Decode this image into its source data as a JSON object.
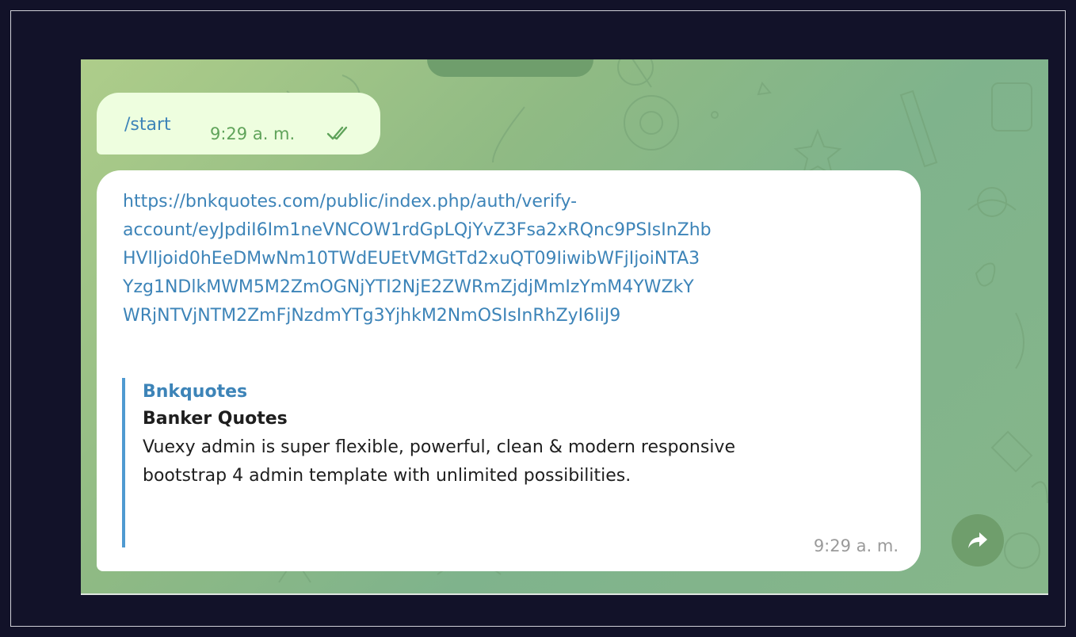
{
  "chat": {
    "outgoing": {
      "text": "/start",
      "time": "9:29 a. m.",
      "status_icon": "double-check-icon"
    },
    "incoming": {
      "link_lines": [
        "https://bnkquotes.com/public/index.php/auth/verify-",
        "account/eyJpdiI6Im1neVNCOW1rdGpLQjYvZ3Fsa2xRQnc9PSIsInZhb",
        "HVlIjoid0hEeDMwNm10TWdEUEtVMGtTd2xuQT09IiwibWFjIjoiNTA3",
        "Yzg1NDlkMWM5M2ZmOGNjYTI2NjE2ZWRmZjdjMmIzYmM4YWZkY",
        "WRjNTVjNTM2ZmFjNzdmYTg3YjhkM2NmOSIsInRhZyI6IiJ9"
      ],
      "preview": {
        "site_name": "Bnkquotes",
        "title": "Banker Quotes",
        "description": "Vuexy admin is super flexible, powerful, clean & modern responsive bootstrap 4 admin template with unlimited possibilities."
      },
      "time": "9:29 a. m."
    },
    "forward_icon": "share-arrow-icon"
  },
  "colors": {
    "page_background": "#121229",
    "outgoing_bubble": "#eefedf",
    "incoming_bubble": "#ffffff",
    "link": "#3d84b8",
    "accent_green": "#6f9e6c"
  }
}
